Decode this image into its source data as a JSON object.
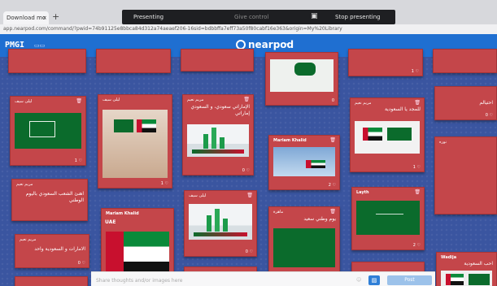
{
  "browser": {
    "tab_title": "Download mo",
    "tab_close": "×",
    "new_tab": "+",
    "url": "app.nearpod.com/command/?pwid=74b91125e8bbca84d312a74aeaef206-16sid=bdbbffa7eff73a50f80cabf16e363&origin=My%20Library"
  },
  "presenting_bar": {
    "label": "Presenting",
    "give_control": "Give control",
    "stop": "Stop presenting",
    "screen_icon": "screen-share-icon"
  },
  "nearpod": {
    "code": "PMGI",
    "logo": "nearpod",
    "caret": "▾",
    "code_icon": "copy-icon"
  },
  "cards": [
    {
      "id": "c1",
      "author": "ليلى سيف",
      "text": "",
      "likes": "1",
      "img": "flag-sa"
    },
    {
      "id": "c2",
      "author": "ليلى سيف",
      "text": "",
      "likes": "1",
      "img": "photo-flags"
    },
    {
      "id": "c3",
      "author": "مريم نعيم",
      "text": "الإماراتي سعودي، و السعودي إماراتي",
      "likes": "0",
      "img": "skyline"
    },
    {
      "id": "c4",
      "author": "",
      "text": "",
      "likes": "0",
      "img": "flag-sa-top"
    },
    {
      "id": "c5",
      "author": "مريم نعيم",
      "text": "للمجد يا السعودية",
      "likes": "1",
      "img": "flags-pair"
    },
    {
      "id": "c6",
      "author": "",
      "text": "احتيالم",
      "likes": "0",
      "img": ""
    },
    {
      "id": "c7",
      "author": "Mariam Khalid",
      "text": "",
      "likes": "2",
      "img": "sky-blue"
    },
    {
      "id": "c8",
      "author": "نوره",
      "text": "",
      "likes": "",
      "img": ""
    },
    {
      "id": "c9",
      "author": "مريم نعيم",
      "text": "اهنئ الشعب السعودي باليوم الوطني",
      "likes": "",
      "img": ""
    },
    {
      "id": "c10",
      "author": "Mariam Khalid",
      "text": "UAE",
      "likes": "",
      "img": "flag-uae"
    },
    {
      "id": "c11",
      "author": "ليلى سيف",
      "text": "",
      "likes": "0",
      "img": "skyline"
    },
    {
      "id": "c12",
      "author": "ماهرة",
      "text": "يوم وطني سعيد",
      "likes": "",
      "img": "flag-sa"
    },
    {
      "id": "c13",
      "author": "Layth",
      "text": "",
      "likes": "2",
      "img": "flag-sa"
    },
    {
      "id": "c14",
      "author": "مريم نعيم",
      "text": "الامارات و السعودية واحد",
      "likes": "0",
      "img": ""
    },
    {
      "id": "c15",
      "author": "Wadija",
      "text": "احب السعودية",
      "likes": "",
      "img": "flags-pair"
    },
    {
      "id": "c16",
      "author": "",
      "text": "",
      "likes": "",
      "img": ""
    },
    {
      "id": "c17",
      "author": "",
      "text": "",
      "likes": "",
      "img": ""
    }
  ],
  "composer": {
    "placeholder": "Share thoughts and/or images here",
    "image_icon": "image-icon",
    "post_label": "Post",
    "small_icon": "emoji-icon"
  }
}
